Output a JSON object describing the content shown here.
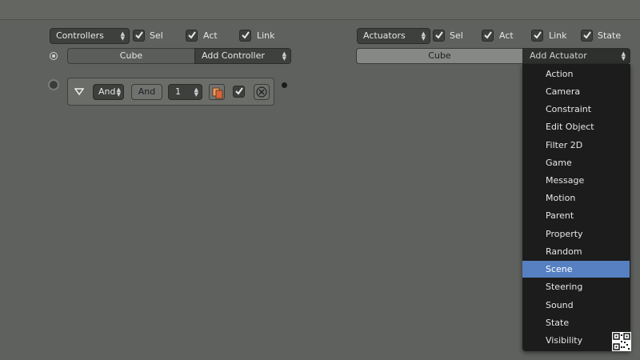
{
  "controllers": {
    "type_select": "Controllers",
    "sel": "Sel",
    "act": "Act",
    "link": "Link",
    "object": "Cube",
    "add": "Add Controller",
    "item": {
      "type": "And",
      "name": "And",
      "state": "1"
    }
  },
  "actuators": {
    "type_select": "Actuators",
    "sel": "Sel",
    "act": "Act",
    "link": "Link",
    "state": "State",
    "object": "Cube",
    "add": "Add Actuator"
  },
  "actuator_menu": {
    "items": [
      "Action",
      "Camera",
      "Constraint",
      "Edit Object",
      "Filter 2D",
      "Game",
      "Message",
      "Motion",
      "Parent",
      "Property",
      "Random",
      "Scene",
      "Steering",
      "Sound",
      "State",
      "Visibility"
    ],
    "active": "Scene"
  },
  "colors": {
    "background": "#5f615e",
    "menu_bg": "#1c1c1c",
    "highlight": "#5680c2"
  }
}
